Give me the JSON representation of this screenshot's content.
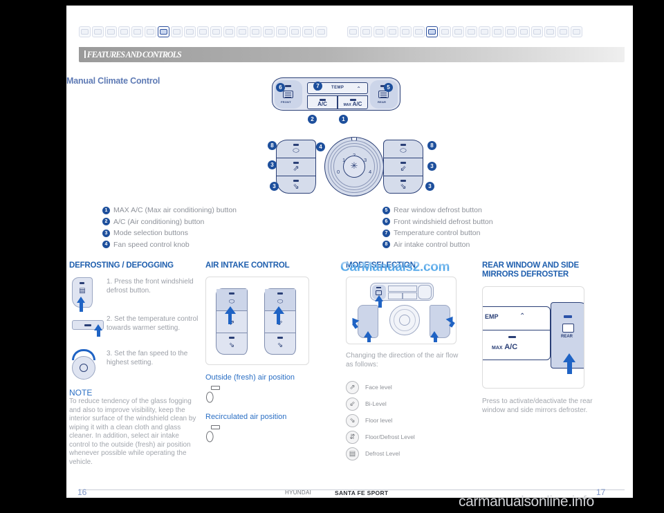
{
  "header": {
    "running_head": "FEATURES AND CONTROLS",
    "tab_icons_left": [
      "key-icon",
      "seat-icon",
      "mirror-icon",
      "wiper-icon",
      "airbag-icon",
      "dashboard-icon",
      "climate-icon",
      "sunroof-icon",
      "antenna-icon",
      "bluetooth-icon",
      "phone-icon",
      "audio-icon",
      "screen-icon",
      "storage-icon",
      "trunk-icon",
      "warning-icon",
      "maintenance-icon",
      "tire-icon",
      "roof-rack-icon"
    ],
    "tab_icons_right": [
      "key-icon",
      "map-icon",
      "remote-icon",
      "mirror-icon",
      "home-icon",
      "dashboard-icon",
      "climate-icon",
      "sunroof-icon",
      "antenna-icon",
      "bluetooth-icon",
      "phone-icon",
      "audio-icon",
      "screen-icon",
      "storage-icon",
      "trunk-icon",
      "power-icon",
      "card-icon",
      "manual-icon"
    ],
    "active_icon_index": 6
  },
  "section": {
    "title": "Manual Climate Control"
  },
  "hero": {
    "headunit": {
      "front_label": "FRONT",
      "rear_label": "REAR",
      "temp_label": "TEMP",
      "chevron_down": "⌄",
      "chevron_up": "⌃",
      "ac_label": "A/C",
      "max_prefix": "MAX",
      "max_label": "A/C"
    },
    "knob": {
      "numbers": [
        "0",
        "1",
        "2",
        "3",
        "4"
      ],
      "fan_glyph": "✳"
    },
    "callouts": [
      "1",
      "2",
      "3",
      "4",
      "5",
      "6",
      "7",
      "8"
    ],
    "pad_icons_left": [
      "air-intake-icon",
      "face-vent-icon",
      "floor-vent-icon"
    ],
    "pad_icons_right": [
      "air-intake-icon",
      "bilevel-vent-icon",
      "floor-vent-icon"
    ]
  },
  "legend": {
    "column1": [
      {
        "num": "1",
        "text": "MAX A/C (Max air conditioning) button"
      },
      {
        "num": "2",
        "text": "A/C (Air conditioning) button"
      },
      {
        "num": "3",
        "text": "Mode selection buttons"
      },
      {
        "num": "4",
        "text": "Fan speed control knob"
      }
    ],
    "column2": [
      {
        "num": "5",
        "text": "Rear window defrost button"
      },
      {
        "num": "6",
        "text": "Front windshield defrost button"
      },
      {
        "num": "7",
        "text": "Temperature control button"
      },
      {
        "num": "8",
        "text": "Air intake control button"
      }
    ]
  },
  "defrosting": {
    "heading": "DEFROSTING / DEFOGGING",
    "steps": [
      {
        "text": "1. Press the front windshield defrost button.",
        "figure": "defrost-button-figure"
      },
      {
        "text": "2. Set the temperature control towards warmer setting.",
        "figure": "temperature-bar-figure"
      },
      {
        "text": "3. Set the fan speed to the highest setting.",
        "figure": "fan-knob-figure"
      }
    ],
    "note_title": "NOTE",
    "note_body": "To reduce tendency of the glass fogging and also to improve visibility, keep the interior surface of the windshield clean by wiping it with a clean cloth and glass cleaner. In addition, select air intake control to the outside (fresh) air position whenever possible while operating the vehicle."
  },
  "air_intake": {
    "heading": "AIR INTAKE CONTROL",
    "outside_label": "Outside (fresh) air position",
    "recirculated_label": "Recirculated air position"
  },
  "mode_selection": {
    "heading": "MODE SELECTION",
    "caption": "Changing the direction of the air flow as follows:",
    "modes": [
      {
        "label": "Face level",
        "icon": "face-vent-icon"
      },
      {
        "label": "Bi-Level",
        "icon": "bilevel-vent-icon"
      },
      {
        "label": "Floor level",
        "icon": "floor-vent-icon"
      },
      {
        "label": "Floor/Defrost Level",
        "icon": "floor-defrost-icon"
      },
      {
        "label": "Defrost Level",
        "icon": "defrost-icon"
      }
    ]
  },
  "rear_defroster": {
    "heading_line1": "REAR WINDOW AND SIDE",
    "heading_line2": "MIRRORS DEFROSTER",
    "caption": "Press to activate/deactivate the rear window and side mirrors defroster.",
    "figure_labels": {
      "temp": "EMP",
      "max_prefix": "MAX",
      "max_label": "A/C",
      "rear": "REAR",
      "chevron_up": "⌃"
    }
  },
  "footer": {
    "page_left": "16",
    "page_right": "17",
    "brand": "HYUNDAI",
    "model": "SANTA FE SPORT"
  },
  "watermarks": {
    "overlay": "CarManuals2.com",
    "bottom": "carmanualsonline.info"
  },
  "colors": {
    "accent_blue": "#1f5fae",
    "diagram_navy": "#2a3f76",
    "bubble_blue": "#1d4f9c",
    "body_gray": "#9a9ea6"
  }
}
